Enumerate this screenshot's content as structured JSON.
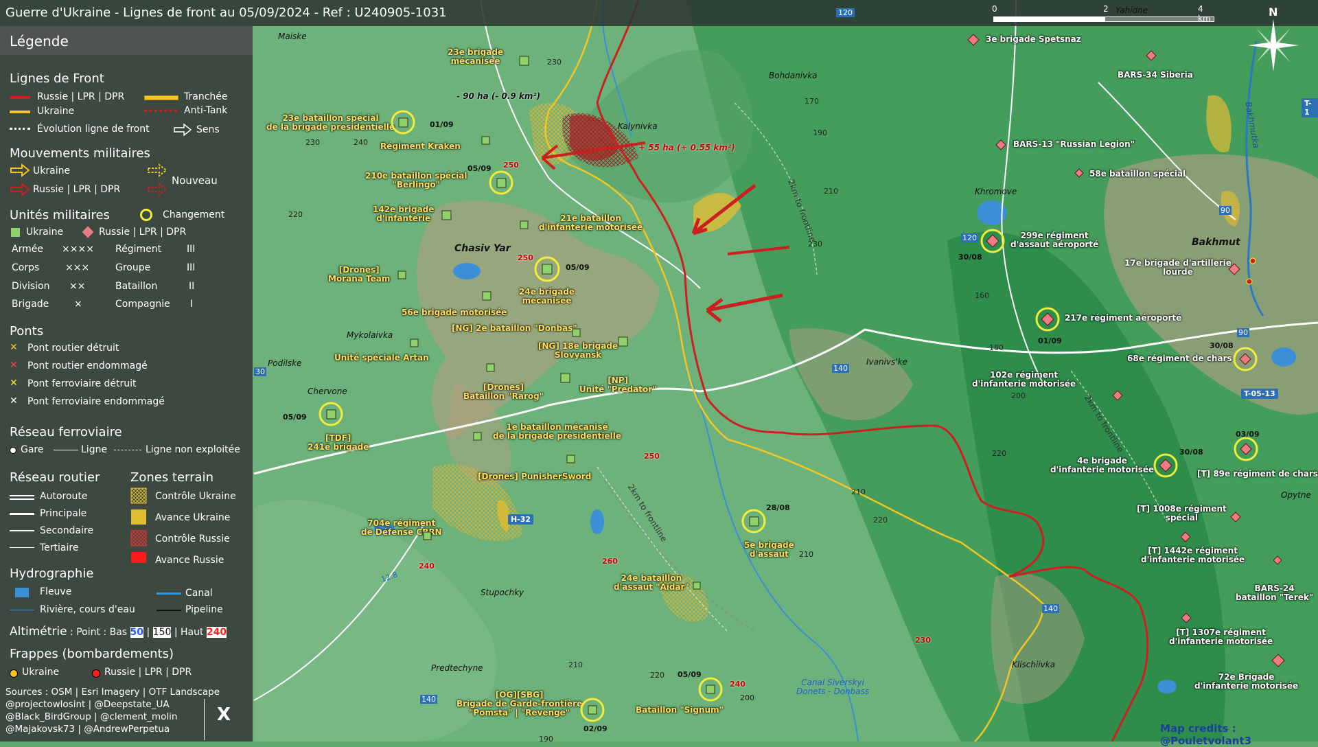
{
  "title": "Guerre d'Ukraine - Lignes de front au 05/09/2024 - Ref : U240905-1031",
  "scale": {
    "s0": "0",
    "s2": "2",
    "s4": "4 km"
  },
  "north": "N",
  "legend": {
    "title": "Légende",
    "front": {
      "heading": "Lignes de Front",
      "russia": "Russie | LPR | DPR",
      "ukraine": "Ukraine",
      "trench": "Tranchée",
      "antitank": "Anti-Tank",
      "evolution": "Évolution ligne de front",
      "sens": "Sens"
    },
    "moves": {
      "heading": "Mouvements militaires",
      "ukraine": "Ukraine",
      "russia": "Russie | LPR | DPR",
      "nouveau": "Nouveau"
    },
    "units": {
      "heading": "Unités militaires",
      "changement": "Changement",
      "ukraine": "Ukraine",
      "russia": "Russie | LPR | DPR",
      "ech": [
        {
          "name": "Armée",
          "sym": "××××"
        },
        {
          "name": "Corps",
          "sym": "×××"
        },
        {
          "name": "Division",
          "sym": "××"
        },
        {
          "name": "Brigade",
          "sym": "×"
        },
        {
          "name": "Régiment",
          "sym": "III"
        },
        {
          "name": "Groupe",
          "sym": "III"
        },
        {
          "name": "Bataillon",
          "sym": "II"
        },
        {
          "name": "Compagnie",
          "sym": "I"
        }
      ]
    },
    "bridges": {
      "heading": "Ponts",
      "b1": "Pont routier détruit",
      "b2": "Pont routier endommagé",
      "b3": "Pont ferroviaire détruit",
      "b4": "Pont ferroviaire endommagé"
    },
    "rail": {
      "heading": "Réseau ferroviaire",
      "gare": "Gare",
      "ligne": "Ligne",
      "nonexp": "Ligne non exploitée"
    },
    "roads": {
      "heading": "Réseau routier",
      "r1": "Autoroute",
      "r2": "Principale",
      "r3": "Secondaire",
      "r4": "Tertiaire"
    },
    "zones": {
      "heading": "Zones terrain",
      "z1": "Contrôle Ukraine",
      "z2": "Avance Ukraine",
      "z3": "Contrôle Russie",
      "z4": "Avance Russie"
    },
    "hydro": {
      "heading": "Hydrographie",
      "fleuve": "Fleuve",
      "canal": "Canal",
      "riviere": "Rivière, cours d'eau",
      "pipeline": "Pipeline"
    },
    "alt": {
      "heading": "Altimétrie",
      "point": " : Point : Bas ",
      "low": "50",
      "sep": " | ",
      "mid": "150",
      "sep2": " | Haut ",
      "high": "240"
    },
    "strikes": {
      "heading": "Frappes (bombardements)",
      "ukraine": "Ukraine",
      "russia": "Russie | LPR | DPR"
    },
    "sources": [
      "Sources : OSM | Esri Imagery | OTF Landscape",
      "@projectowlosint | @Deepstate_UA",
      "@Black_BirdGroup | @clement_molin",
      "@Majakovsk73 | @AndrewPerpetua"
    ],
    "x_icon": "X"
  },
  "colors": {
    "russia": "#cc1f1f",
    "ukraine": "#f2c624",
    "terrain": "#5fa86e",
    "panel": "#373c3a",
    "ukr_unit": "#8fd16a",
    "rus_unit": "#ef7b86"
  },
  "places": [
    {
      "id": "maiske",
      "text": "Maiske"
    },
    {
      "id": "bohdanivka",
      "text": "Bohdanivka"
    },
    {
      "id": "kalynivka",
      "text": "Kalynivka"
    },
    {
      "id": "chasivyar",
      "text": "Chasiv Yar"
    },
    {
      "id": "mykolaivka",
      "text": "Mykolaivka"
    },
    {
      "id": "podilske",
      "text": "Podilske"
    },
    {
      "id": "chervone",
      "text": "Chervone"
    },
    {
      "id": "stupochky",
      "text": "Stupochky"
    },
    {
      "id": "predtechyne",
      "text": "Predtechyne"
    },
    {
      "id": "ivanivske",
      "text": "Ivanivs'ke"
    },
    {
      "id": "khromove",
      "text": "Khromove"
    },
    {
      "id": "bakhmut",
      "text": "Bakhmut"
    },
    {
      "id": "klischiivka",
      "text": "Klischiivka"
    },
    {
      "id": "opytne",
      "text": "Opytne"
    },
    {
      "id": "yahidne",
      "text": "Yahidne"
    },
    {
      "id": "bakhmutka",
      "text": "Bakhmutka"
    }
  ],
  "altitudes": [
    "230",
    "230",
    "240",
    "220",
    "120",
    "170",
    "190",
    "210",
    "230",
    "160",
    "180",
    "200",
    "220",
    "210",
    "220",
    "210",
    "200",
    "230",
    "210",
    "250",
    "250",
    "250",
    "260",
    "240",
    "220",
    "190",
    "240",
    "12.8",
    "140",
    "140",
    "140",
    "120",
    "90",
    "90",
    "30"
  ],
  "ukr_units": [
    {
      "id": "u23meca",
      "label": "23e brigade\nmécanisée"
    },
    {
      "id": "u23bat",
      "label": "23e bataillon spécial\nde la brigade présidentielle"
    },
    {
      "id": "ukraken",
      "label": "Régiment Kraken"
    },
    {
      "id": "u210",
      "label": "210e bataillon spécial\n\"Berlingo\""
    },
    {
      "id": "u142",
      "label": "142e brigade\nd'infanterie"
    },
    {
      "id": "u21",
      "label": "21e bataillon\nd'infanterie motorisée"
    },
    {
      "id": "umorana",
      "label": "[Drones]\nMorana Team"
    },
    {
      "id": "u24",
      "label": "24e brigade\nmécanisée"
    },
    {
      "id": "u56",
      "label": "56e brigade motorisée"
    },
    {
      "id": "udonbas",
      "label": "[NG] 2e bataillon \"Donbas\""
    },
    {
      "id": "u18",
      "label": "[NG] 18e brigade\nSlovyansk"
    },
    {
      "id": "uartan",
      "label": "Unité spéciale Artan"
    },
    {
      "id": "urarog",
      "label": "[Drones]\nBataillon \"Rarog\""
    },
    {
      "id": "upredator",
      "label": "[NP]\nUnité \"Predator\""
    },
    {
      "id": "u241",
      "label": "[TDF]\n241e brigade"
    },
    {
      "id": "u1meca",
      "label": "1e bataillon mécanisé\nde la brigade présidentielle"
    },
    {
      "id": "upunisher",
      "label": "[Drones] PunisherSword"
    },
    {
      "id": "u704",
      "label": "704e régiment\nde Défense CBRN"
    },
    {
      "id": "u5",
      "label": "5e brigade\nd'assaut"
    },
    {
      "id": "u24aidar",
      "label": "24e bataillon\nd'assaut \"Aidar\""
    },
    {
      "id": "upomsta",
      "label": "[OG][SBG]\nBrigade de Garde-frontière\n\"Pomsta\" | \"Revenge\""
    },
    {
      "id": "usignum",
      "label": "Bataillon \"Signum\""
    }
  ],
  "rus_units": [
    {
      "id": "r3spetsnaz",
      "label": "3e brigade Spetsnaz"
    },
    {
      "id": "rbars34",
      "label": "BARS-34 Siberia"
    },
    {
      "id": "rbars13",
      "label": "BARS-13 \"Russian Legion\""
    },
    {
      "id": "r58",
      "label": "58e bataillon spécial"
    },
    {
      "id": "r299",
      "label": "299e régiment\nd'assaut aéroporté"
    },
    {
      "id": "r17",
      "label": "17e brigade d'artillerie\nlourde"
    },
    {
      "id": "r217",
      "label": "217e régiment aéroporté"
    },
    {
      "id": "r68",
      "label": "68e régiment de chars"
    },
    {
      "id": "r102",
      "label": "102e régiment\nd'infanterie motorisée"
    },
    {
      "id": "r4",
      "label": "4e brigade\nd'infanterie motorisée"
    },
    {
      "id": "r89",
      "label": "[T] 89e régiment de chars"
    },
    {
      "id": "r1008",
      "label": "[T] 1008e régiment\nspécial"
    },
    {
      "id": "r1442",
      "label": "[T] 1442e régiment\nd'infanterie motorisée"
    },
    {
      "id": "rbars24",
      "label": "BARS-24\nbataillon \"Terek\""
    },
    {
      "id": "r1307",
      "label": "[T] 1307e régiment\nd'infanterie motorisée"
    },
    {
      "id": "r72",
      "label": "72e Brigade\nd'infanterie motorisée"
    }
  ],
  "dates": [
    "01/09",
    "05/09",
    "05/09",
    "05/09",
    "28/08",
    "05/09",
    "02/09",
    "30/08",
    "01/09",
    "30/08",
    "03/09",
    "30/08"
  ],
  "annotations": {
    "ukr_ha": "- 90 ha (- 0.9 km²)",
    "rus_ha": "+ 55 ha (+ 0.55 km²)",
    "canal": "Canal Siverskyi\nDonets - Donbass",
    "frontline_a": "2km to frontline",
    "frontline_b": "2km to frontline",
    "frontline_c": "2km to frontline"
  },
  "road_badges": [
    "H-32",
    "T-05-13",
    "T-1"
  ],
  "credits": "Map credits : @Pouletvolant3"
}
